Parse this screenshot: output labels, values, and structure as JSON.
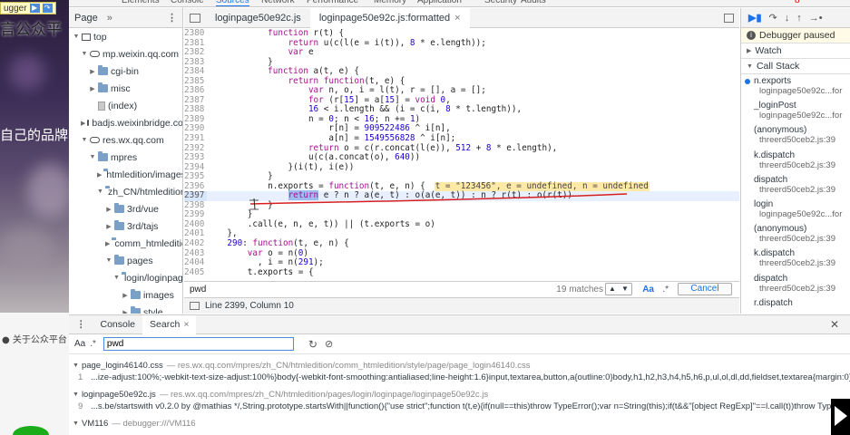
{
  "webpage": {
    "paused_badge": "ugger",
    "title1": "言公众平",
    "title2": "自己的品牌",
    "footer": "● 关于公众平台"
  },
  "devtools_tabs": [
    "Elements",
    "Console",
    "Sources",
    "Network",
    "Performance",
    "Memory",
    "Application",
    "Security",
    "Audits"
  ],
  "devtools_active_tab": "Sources",
  "error_count": "8",
  "navigator": {
    "tab": "Page",
    "more": "»",
    "tree": [
      {
        "label": "top",
        "indent": 0,
        "icon": "frame",
        "tri": "▼"
      },
      {
        "label": "mp.weixin.qq.com",
        "indent": 1,
        "icon": "cloud",
        "tri": "▼"
      },
      {
        "label": "cgi-bin",
        "indent": 2,
        "icon": "folder",
        "tri": "▶"
      },
      {
        "label": "misc",
        "indent": 2,
        "icon": "folder",
        "tri": "▶"
      },
      {
        "label": "(index)",
        "indent": 2,
        "icon": "file",
        "tri": ""
      },
      {
        "label": "badjs.weixinbridge.com",
        "indent": 1,
        "icon": "cloud",
        "tri": "▶"
      },
      {
        "label": "res.wx.qq.com",
        "indent": 1,
        "icon": "cloud",
        "tri": "▼"
      },
      {
        "label": "mpres",
        "indent": 2,
        "icon": "folder",
        "tri": "▼"
      },
      {
        "label": "htmledition/images",
        "indent": 3,
        "icon": "folder",
        "tri": "▶"
      },
      {
        "label": "zh_CN/htmledition",
        "indent": 3,
        "icon": "folder",
        "tri": "▼"
      },
      {
        "label": "3rd/vue",
        "indent": 4,
        "icon": "folder",
        "tri": "▶"
      },
      {
        "label": "3rd/tajs",
        "indent": 4,
        "icon": "folder",
        "tri": "▶"
      },
      {
        "label": "comm_htmledition",
        "indent": 4,
        "icon": "folder",
        "tri": "▶"
      },
      {
        "label": "pages",
        "indent": 4,
        "icon": "folder",
        "tri": "▼"
      },
      {
        "label": "login/loginpage",
        "indent": 5,
        "icon": "folder",
        "tri": "▼"
      },
      {
        "label": "images",
        "indent": 6,
        "icon": "folder",
        "tri": "▶"
      },
      {
        "label": "style",
        "indent": 6,
        "icon": "folder",
        "tri": "▶"
      },
      {
        "label": "loginpage50e92c.js",
        "indent": 6,
        "icon": "filey",
        "tri": "",
        "selected": true
      },
      {
        "label": "loginpage50e92c.js",
        "indent": 6,
        "icon": "filey",
        "tri": ""
      },
      {
        "label": "modules",
        "indent": 5,
        "icon": "folder",
        "tri": "▶"
      },
      {
        "label": "threerd50ceb2.js",
        "indent": 5,
        "icon": "fileg",
        "tri": ""
      }
    ]
  },
  "editor": {
    "tabs": [
      {
        "label": "loginpage50e92c.js",
        "active": false,
        "closable": false
      },
      {
        "label": "loginpage50e92c.js:formatted",
        "active": true,
        "closable": true
      }
    ],
    "lines": [
      {
        "n": "2380",
        "code": "            function r(t) {"
      },
      {
        "n": "2381",
        "code": "                return u(c(l(e = i(t)), 8 * e.length));"
      },
      {
        "n": "2382",
        "code": "                var e"
      },
      {
        "n": "2383",
        "code": "            }"
      },
      {
        "n": "2384",
        "code": "            function a(t, e) {"
      },
      {
        "n": "2385",
        "code": "                return function(t, e) {"
      },
      {
        "n": "2386",
        "code": "                    var n, o, i = l(t), r = [], a = [];"
      },
      {
        "n": "2387",
        "code": "                    for (r[15] = a[15] = void 0,"
      },
      {
        "n": "2388",
        "code": "                    16 < i.length && (i = c(i, 8 * t.length)),"
      },
      {
        "n": "2389",
        "code": "                    n = 0; n < 16; n += 1)"
      },
      {
        "n": "2390",
        "code": "                        r[n] = 909522486 ^ i[n],"
      },
      {
        "n": "2391",
        "code": "                        a[n] = 1549556828 ^ i[n];"
      },
      {
        "n": "2392",
        "code": "                    return o = c(r.concat(l(e)), 512 + 8 * e.length),"
      },
      {
        "n": "2393",
        "code": "                    u(c(a.concat(o), 640))"
      },
      {
        "n": "2394",
        "code": "                }(i(t), i(e))"
      },
      {
        "n": "2395",
        "code": "            }"
      },
      {
        "n": "2396",
        "code": "            n.exports = function(t, e, n) {",
        "preview": "t = \"123456\", e = undefined, n = undefined"
      },
      {
        "n": "2397",
        "code": "                return e ? n ? a(e, t) : o(a(e, t)) : n ? r(t) : o(r(t))",
        "highlight": true
      },
      {
        "n": "2398",
        "code": "            }"
      },
      {
        "n": "2399",
        "code": "        }"
      },
      {
        "n": "2400",
        "code": "        .call(e, n, e, t)) || (t.exports = o)"
      },
      {
        "n": "2401",
        "code": "    },"
      },
      {
        "n": "2402",
        "code": "    290: function(t, e, n) {"
      },
      {
        "n": "2403",
        "code": "        var o = n(0)"
      },
      {
        "n": "2404",
        "code": "          , i = n(291);"
      },
      {
        "n": "2405",
        "code": "        t.exports = {"
      }
    ],
    "search": {
      "value": "pwd",
      "matches": "19 matches",
      "case_label": "Aa",
      "regex_label": ".*",
      "cancel": "Cancel"
    },
    "status": "Line 2399, Column 10"
  },
  "debugger": {
    "paused": "Debugger paused",
    "watch": "Watch",
    "call_stack": "Call Stack",
    "frames": [
      {
        "fn": "n.exports",
        "loc": "loginpage50e92c...for",
        "current": true
      },
      {
        "fn": "_loginPost",
        "loc": "loginpage50e92c...for"
      },
      {
        "fn": "(anonymous)",
        "loc": "threerd50ceb2.js:39"
      },
      {
        "fn": "k.dispatch",
        "loc": "threerd50ceb2.js:39"
      },
      {
        "fn": "dispatch",
        "loc": "threerd50ceb2.js:39"
      },
      {
        "fn": "login",
        "loc": "loginpage50e92c...for"
      },
      {
        "fn": "(anonymous)",
        "loc": "threerd50ceb2.js:39"
      },
      {
        "fn": "k.dispatch",
        "loc": "threerd50ceb2.js:39"
      },
      {
        "fn": "dispatch",
        "loc": "threerd50ceb2.js:39"
      },
      {
        "fn": "r.dispatch",
        "loc": ""
      }
    ]
  },
  "drawer": {
    "tabs": [
      {
        "label": "Console",
        "active": false,
        "closable": false
      },
      {
        "label": "Search",
        "active": true,
        "closable": true
      }
    ],
    "search_value": "pwd",
    "case_label": "Aa",
    "regex_label": ".*",
    "results": [
      {
        "file": "page_login46140.css",
        "path": "— res.wx.qq.com/mpres/zh_CN/htmledition/comm_htmledition/style/page/page_login46140.css",
        "line_no": "1",
        "text": "...ize-adjust:100%;-webkit-text-size-adjust:100%}body{-webkit-font-smoothing:antialiased;line-height:1.6}input,textarea,button,a{outline:0}body,h1,h2,h3,h4,h5,h6,p,ul,ol,dl,dd,fieldset,textarea{margin:0}fields..."
      },
      {
        "file": "loginpage50e92c.js",
        "path": "— res.wx.qq.com/mpres/zh_CN/htmledition/pages/login/loginpage/loginpage50e92c.js",
        "line_no": "9",
        "text": "...s.be/startswith v0.2.0 by @mathias */,String.prototype.startsWith||function(){\"use strict\";function t(t,e){if(null==this)throw TypeError();var n=String(this);if(t&&\"[object RegExp]\"==l.call(t))throw TypeError();var o=n..."
      },
      {
        "file": "VM116",
        "path": "— debugger:///VM116",
        "line_no": "",
        "text": ""
      }
    ]
  }
}
